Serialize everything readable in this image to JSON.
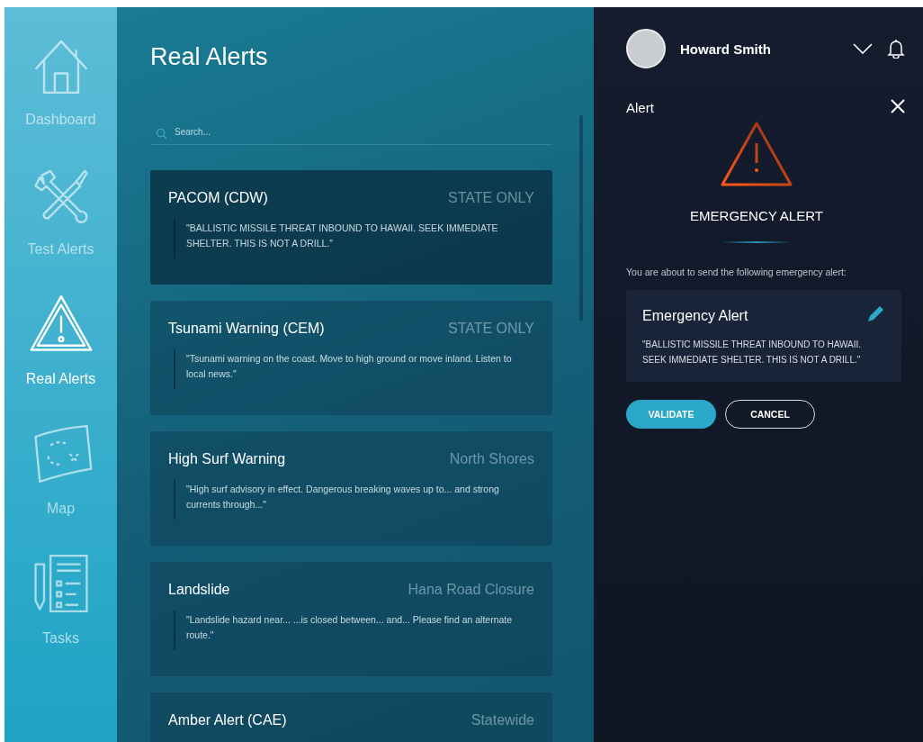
{
  "sidebar": {
    "items": [
      {
        "label": "Dashboard",
        "selected": false
      },
      {
        "label": "Test Alerts",
        "selected": false
      },
      {
        "label": "Real Alerts",
        "selected": true
      },
      {
        "label": "Map",
        "selected": false
      },
      {
        "label": "Tasks",
        "selected": false
      }
    ]
  },
  "main": {
    "title": "Real Alerts",
    "search": {
      "placeholder": "Search..."
    },
    "alerts": [
      {
        "title": "PACOM (CDW)",
        "scope": "STATE ONLY",
        "message": "\"BALLISTIC MISSILE THREAT INBOUND TO HAWAII. SEEK IMMEDIATE SHELTER. THIS IS NOT A DRILL.\"",
        "selected": true
      },
      {
        "title": "Tsunami Warning (CEM)",
        "scope": "STATE ONLY",
        "message": "\"Tsunami warning on the coast. Move to high ground or move inland. Listen to local news.\"",
        "selected": false
      },
      {
        "title": "High Surf Warning",
        "scope": "North Shores",
        "message": "\"High surf advisory in effect. Dangerous breaking waves up to... and strong currents through...\"",
        "selected": false
      },
      {
        "title": "Landslide",
        "scope": "Hana Road Closure",
        "message": "\"Landslide hazard near... ...is closed between... and... Please find an alternate route.\"",
        "selected": false
      },
      {
        "title": "Amber Alert (CAE)",
        "scope": "Statewide",
        "selected": false
      }
    ]
  },
  "panel": {
    "user": {
      "name": "Howard Smith"
    },
    "title": "Alert",
    "heading": "EMERGENCY ALERT",
    "intro": "You are about to send the following emergency alert:",
    "alert": {
      "title": "Emergency Alert",
      "message": "\"BALLISTIC MISSILE THREAT INBOUND TO HAWAII. SEEK IMMEDIATE SHELTER. THIS IS NOT A DRILL.\""
    },
    "buttons": [
      {
        "label": "VALIDATE",
        "kind": "primary"
      },
      {
        "label": "CANCEL",
        "kind": "outline"
      }
    ]
  }
}
